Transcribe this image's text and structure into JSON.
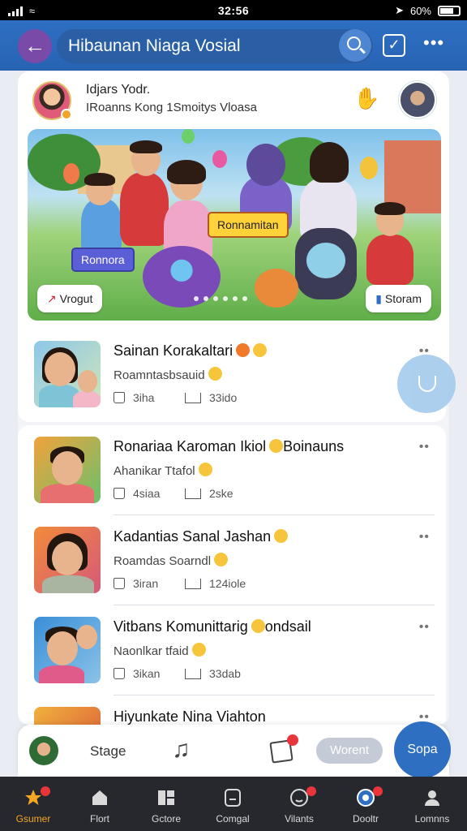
{
  "status": {
    "time": "32:56",
    "battery": "60%"
  },
  "header": {
    "title": "Hibaunan Niaga Vosial"
  },
  "profile": {
    "name": "Idjars Yodr.",
    "subtitle": "IRoanns Kong 1Smoitys Vloasa"
  },
  "banner": {
    "center_label": "Ronnamitan",
    "left_label": "Ronnora",
    "left_button": "Vrogut",
    "right_button": "Storam"
  },
  "feed": [
    {
      "title": "Sainan Korakaltari",
      "sub": "Roamntasbsauid",
      "likes": "3iha",
      "shares": "33ido",
      "emoji_title": 2
    },
    {
      "title": "Ronariaa Karoman Ikiol",
      "title_tail": "Boinauns",
      "sub": "Ahanikar Ttafol",
      "likes": "4siaa",
      "shares": "2ske"
    },
    {
      "title": "Kadantias Sanal Jashan",
      "sub": "Roamdas Soarndl",
      "likes": "3iran",
      "shares": "124iole"
    },
    {
      "title": "Vitbans Komunittarig",
      "title_tail": "ondsail",
      "sub": "Naonlkar tfaid",
      "likes": "3ikan",
      "shares": "33dab"
    },
    {
      "title": "Hiyunkate Nina Viahton"
    }
  ],
  "compose": {
    "stage_label": "Stage",
    "pill_label": "Worent",
    "post_label": "Sopa"
  },
  "nav": [
    {
      "label": "Gsumer",
      "icon": "star-icon",
      "active": true,
      "badge": true
    },
    {
      "label": "Flort",
      "icon": "home-icon"
    },
    {
      "label": "Gctore",
      "icon": "grid-icon"
    },
    {
      "label": "Comgal",
      "icon": "chat-icon"
    },
    {
      "label": "Vilants",
      "icon": "face-icon",
      "badge": true
    },
    {
      "label": "Dooltr",
      "icon": "globe-icon",
      "badge": true
    },
    {
      "label": "Lomnns",
      "icon": "person-icon"
    }
  ],
  "colors": {
    "header": "#2e6fc2",
    "accent": "#f5a623",
    "nav_bg": "#26282e",
    "badge": "#e8343a"
  }
}
